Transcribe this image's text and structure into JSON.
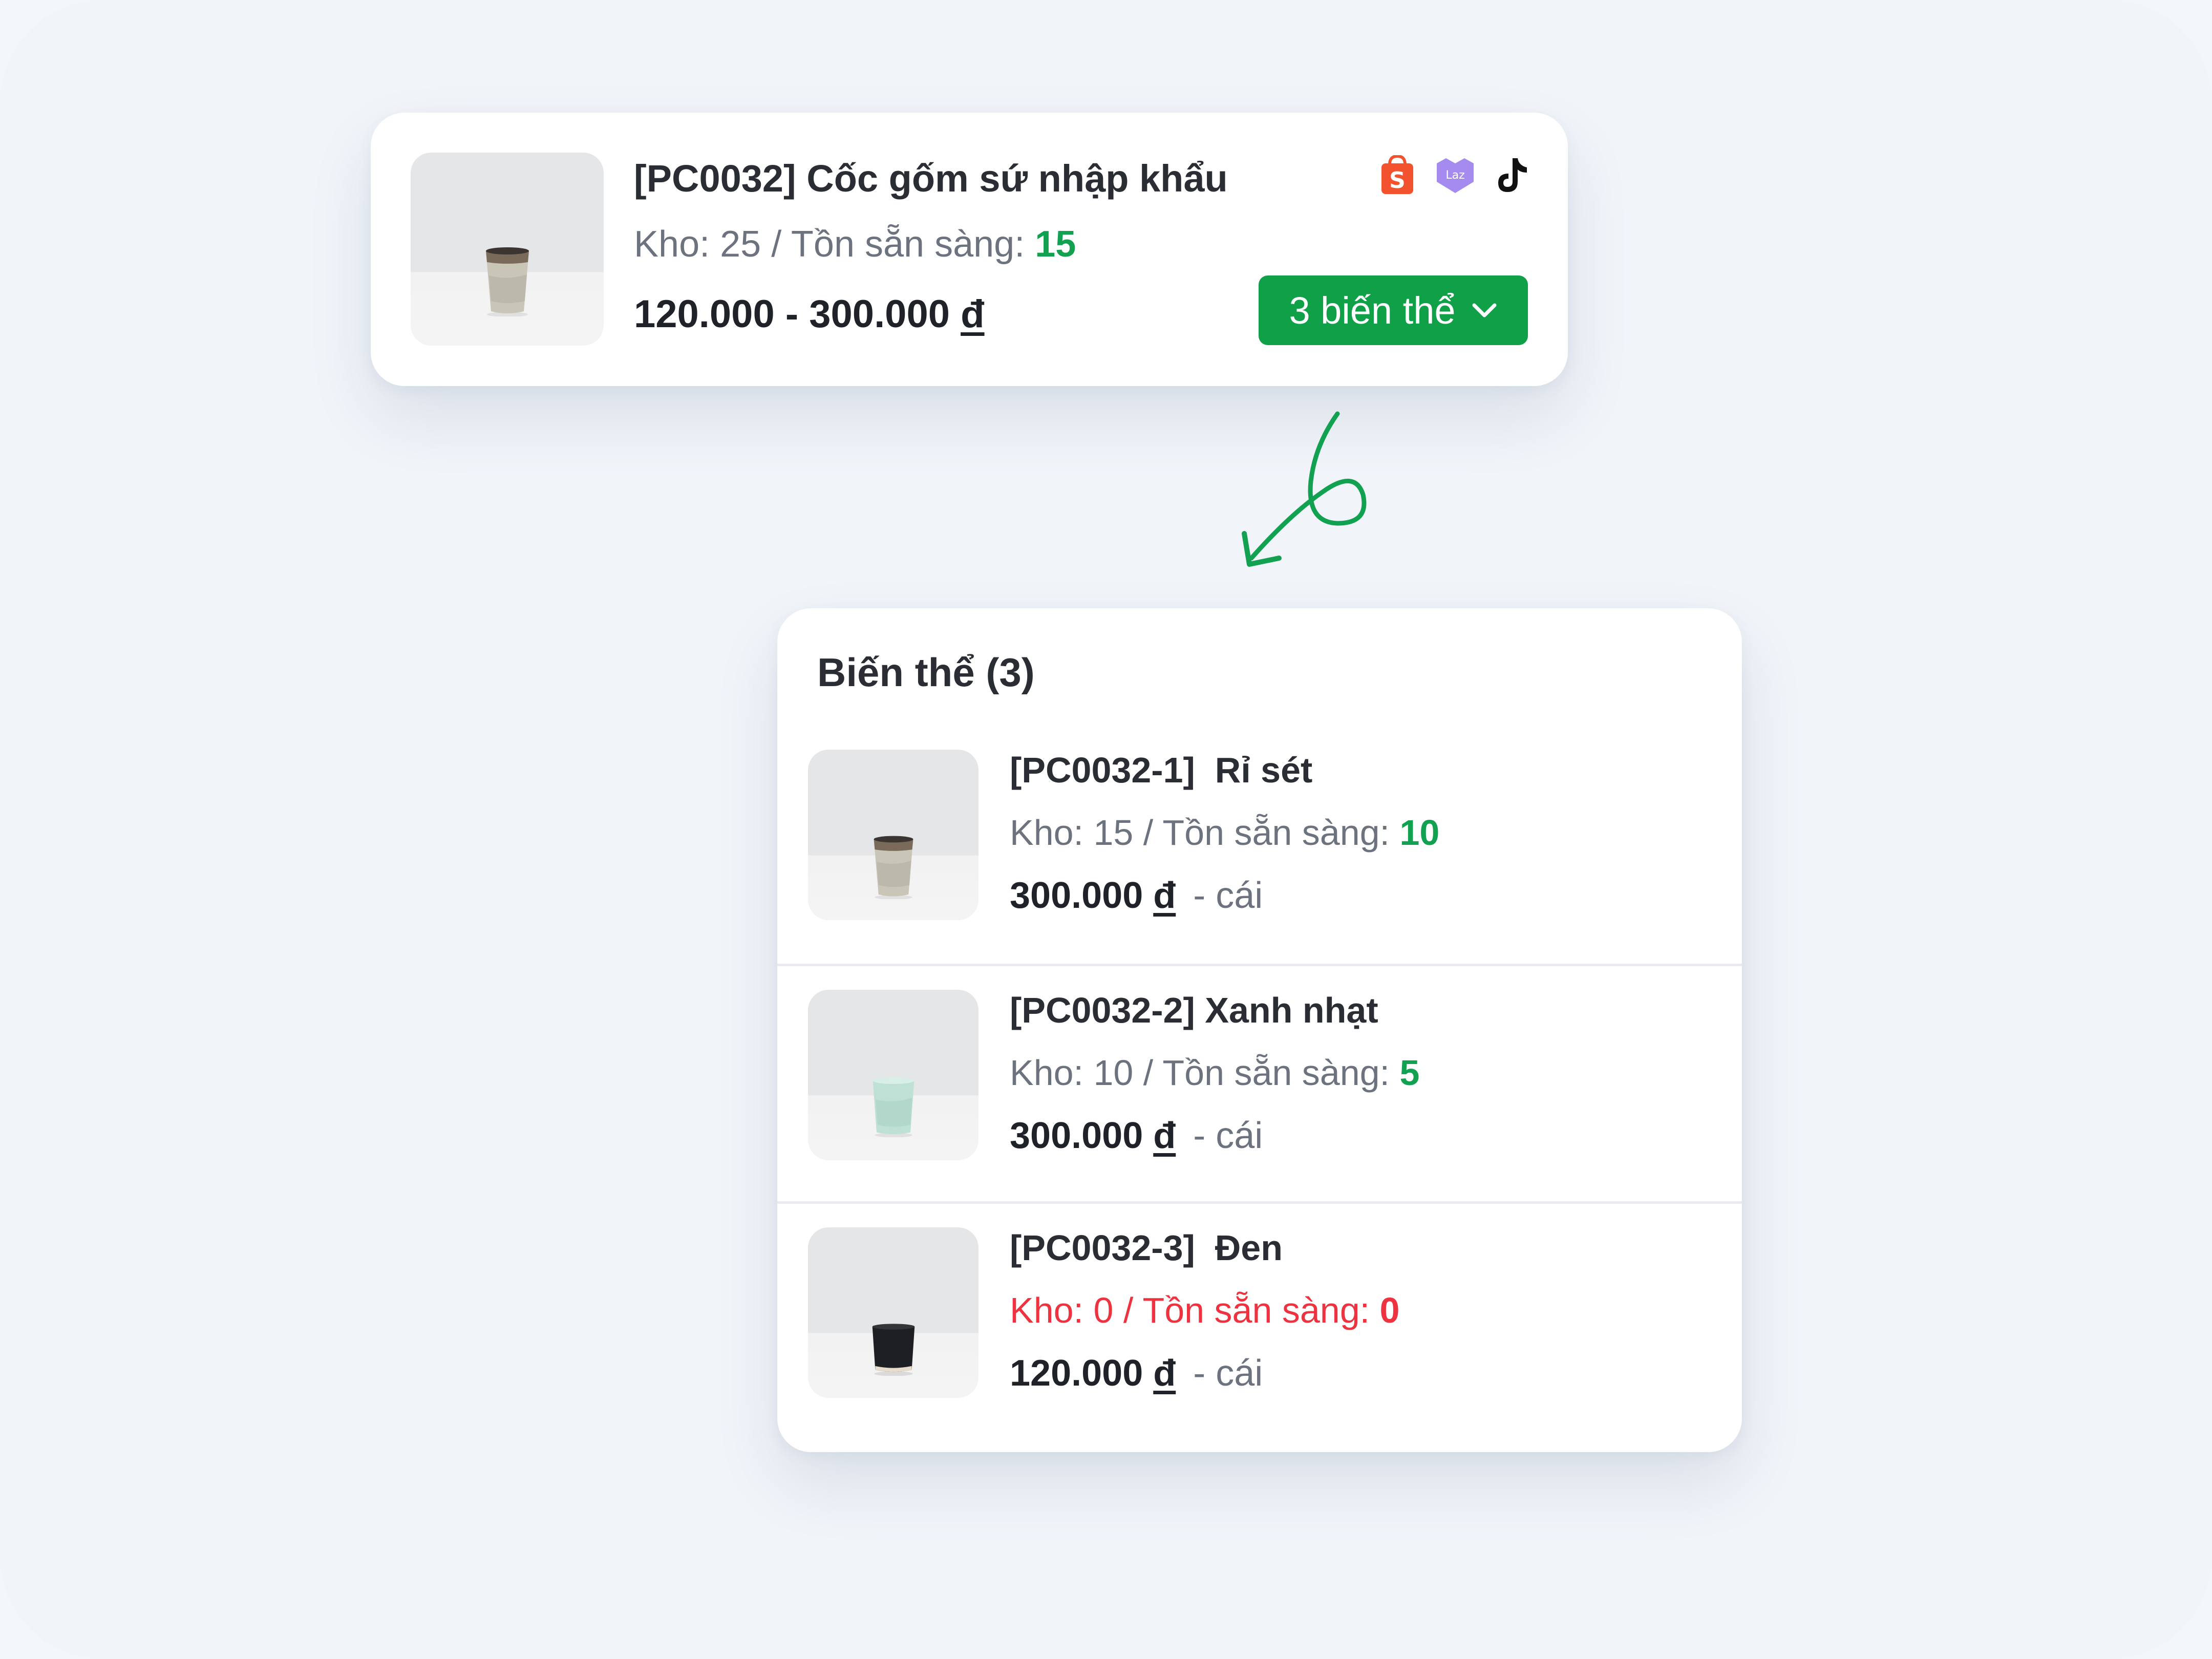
{
  "product": {
    "title": "[PC0032] Cốc gốm sứ nhập khẩu",
    "stock_label": "Kho: 25 / Tồn sẵn sàng:",
    "stock_available": "15",
    "price_range": "120.000 - 300.000",
    "currency": "đ",
    "channel_icons": [
      "shopee-icon",
      "lazada-icon",
      "tiktok-icon"
    ],
    "shopee_glyph": "S",
    "lazada_glyph": "Laz",
    "variants_button_label": "3 biến thể"
  },
  "variants_panel": {
    "title": "Biến thể (3)",
    "items": [
      {
        "code": "[PC0032-1]",
        "name": "Rỉ sét",
        "stock_label": "Kho: 15 / Tồn sẵn sàng:",
        "stock_available": "10",
        "price": "300.000",
        "currency": "đ",
        "unit": "- cái",
        "status": "in-stock",
        "cup_color": "#c9c6b8"
      },
      {
        "code": "[PC0032-2]",
        "name": "Xanh nhạt",
        "stock_label": "Kho: 10 / Tồn sẵn sàng:",
        "stock_available": "5",
        "price": "300.000",
        "currency": "đ",
        "unit": "- cái",
        "status": "in-stock",
        "cup_color": "#bfe0d5"
      },
      {
        "code": "[PC0032-3]",
        "name": "Đen",
        "stock_label": "Kho: 0 / Tồn sẵn sàng:",
        "stock_available": "0",
        "price": "120.000",
        "currency": "đ",
        "unit": "- cái",
        "status": "out-of-stock",
        "cup_color": "#1e1f22"
      }
    ]
  },
  "colors": {
    "accent_green": "#0fa048",
    "available_green": "#12a150",
    "out_of_stock_red": "#ee3340",
    "shopee_orange": "#f2522e",
    "lazada_purple": "#a58bf0"
  }
}
